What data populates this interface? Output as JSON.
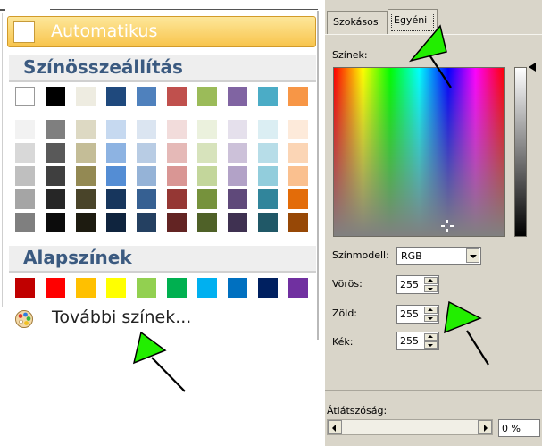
{
  "palette": {
    "automatic_label": "Automatikus",
    "theme_colors_title": "Színösszeállítás",
    "standard_colors_title": "Alapszínek",
    "more_colors_label": "További színek...",
    "theme_top_row": [
      "#ffffff",
      "#000000",
      "#eeece1",
      "#1f497d",
      "#4f81bd",
      "#c0504d",
      "#9bbb59",
      "#8064a2",
      "#4bacc6",
      "#f79646"
    ],
    "theme_shades": [
      [
        "#f2f2f2",
        "#d8d8d8",
        "#bfbfbf",
        "#a5a5a5",
        "#7f7f7f"
      ],
      [
        "#7f7f7f",
        "#595959",
        "#3f3f3f",
        "#262626",
        "#0c0c0c"
      ],
      [
        "#ddd9c3",
        "#c4bd97",
        "#938953",
        "#494429",
        "#1d1b10"
      ],
      [
        "#c6d9f0",
        "#8db3e2",
        "#548dd4",
        "#17365d",
        "#0f243e"
      ],
      [
        "#dbe5f1",
        "#b8cce4",
        "#95b3d7",
        "#366092",
        "#244061"
      ],
      [
        "#f2dcdb",
        "#e5b9b7",
        "#d99694",
        "#953734",
        "#632423"
      ],
      [
        "#ebf1dd",
        "#d7e3bc",
        "#c3d69b",
        "#76923c",
        "#4f6128"
      ],
      [
        "#e5e0ec",
        "#ccc1d9",
        "#b2a2c7",
        "#5f497a",
        "#3f3151"
      ],
      [
        "#dbeef3",
        "#b7dde8",
        "#92cddc",
        "#31859b",
        "#205867"
      ],
      [
        "#fdeada",
        "#fbd5b5",
        "#fac08f",
        "#e36c09",
        "#974806"
      ]
    ],
    "standard_colors": [
      "#c00000",
      "#ff0000",
      "#ffc000",
      "#ffff00",
      "#92d050",
      "#00b050",
      "#00b0f0",
      "#0070c0",
      "#002060",
      "#7030a0"
    ]
  },
  "dialog": {
    "tab_standard": "Szokásos",
    "tab_custom": "Egyéni",
    "colors_label": "Színek:",
    "color_model_label": "Színmodell:",
    "color_model_value": "RGB",
    "red_label": "Vörös:",
    "red_value": "255",
    "green_label": "Zöld:",
    "green_value": "255",
    "blue_label": "Kék:",
    "blue_value": "255",
    "transparency_label": "Átlátszóság:",
    "transparency_value": "0 %"
  },
  "colors": {
    "annotation_arrow": "#22ee00",
    "selected_highlight": "#f8c44c",
    "heading_text": "#3b5a80"
  }
}
